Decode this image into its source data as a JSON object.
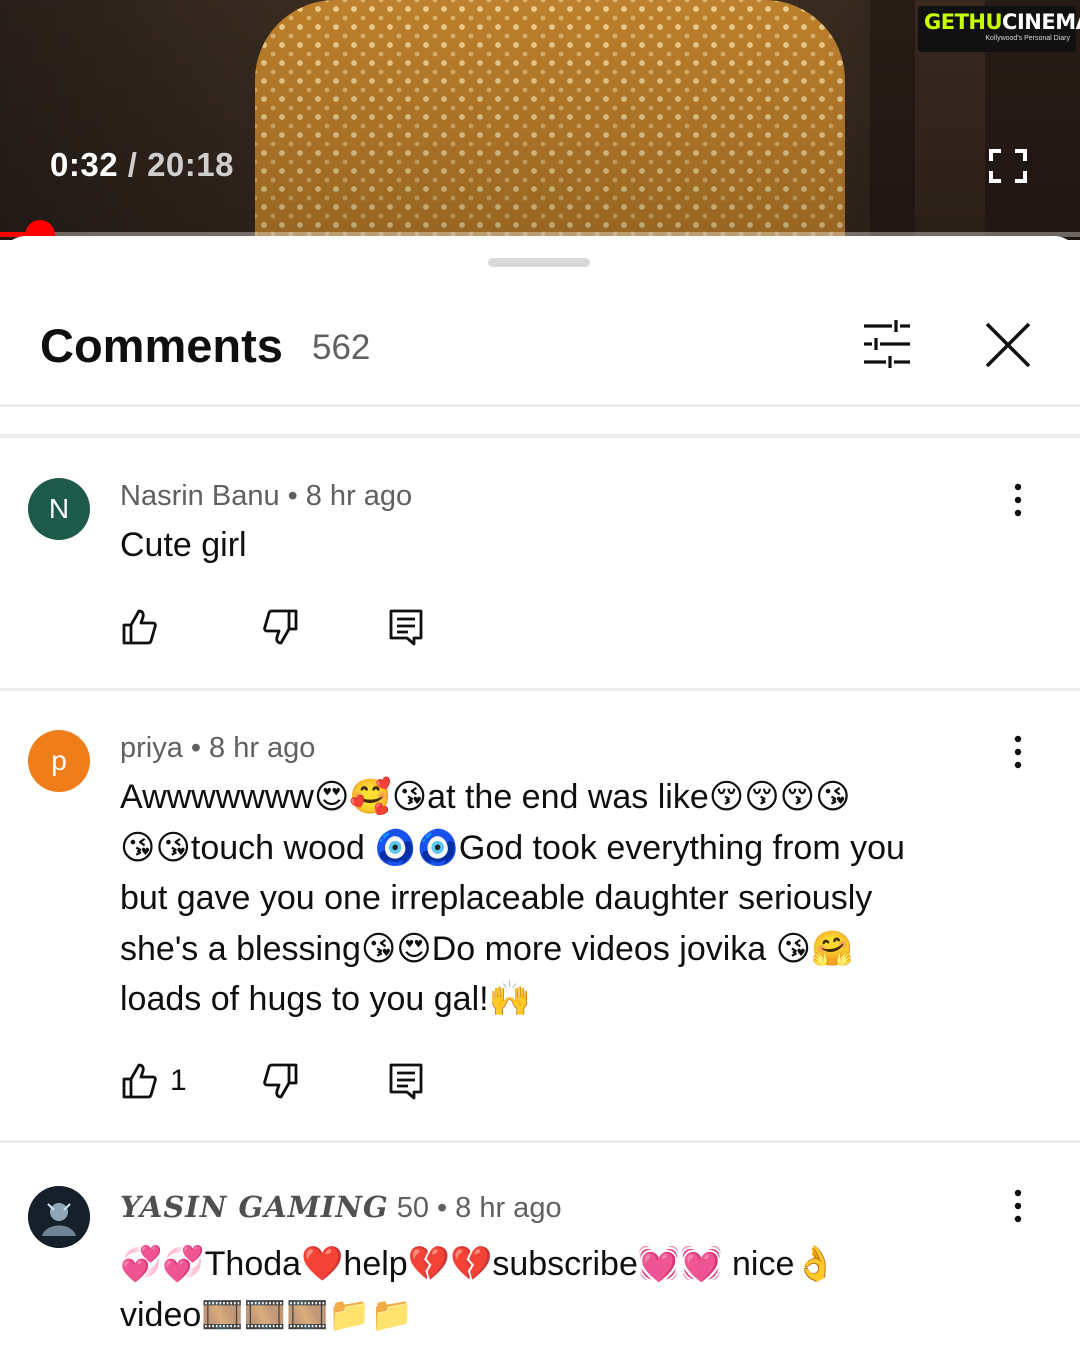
{
  "player": {
    "current_time": "0:32",
    "duration": "/ 20:18",
    "progress_fraction": 0.026
  },
  "watermark": {
    "brand_left": "GETHU",
    "brand_right": "CINEMA",
    "tagline": "Kollywood's Personal Diary"
  },
  "comments_panel": {
    "title": "Comments",
    "count": "562"
  },
  "comments": [
    {
      "avatar_letter": "N",
      "avatar_color": "#1e5a4a",
      "author": "Nasrin Banu",
      "separator": "•",
      "time": "8 hr ago",
      "text": "Cute girl",
      "likes": ""
    },
    {
      "avatar_letter": "p",
      "avatar_color": "#ef7d1a",
      "author": "priya",
      "separator": "•",
      "time": "8 hr ago",
      "text_lines": [
        "Awwwwwww😍🥰😘at the end was like😚😚😚😘",
        "😘😘touch wood 🧿🧿God took everything from you",
        "but gave you one irreplaceable daughter seriously",
        "she's a blessing😘😍Do more videos jovika 😘🤗",
        "loads of hugs to you gal!🙌"
      ],
      "likes": "1"
    },
    {
      "avatar_letter": "",
      "avatar_color": "#1b2530",
      "author": "YASIN GAMING",
      "author_suffix": "50",
      "separator": "•",
      "time": "8 hr ago",
      "text_lines": [
        "💞💞Thoda❤️help💔💔subscribe💓💓 nice👌",
        "video🎞️🎞️🎞️📁📁"
      ]
    }
  ],
  "colors": {
    "accent": "#ff0000",
    "secondary_text": "#606060",
    "primary_text": "#0f0f0f"
  },
  "icons": [
    "fullscreen-icon",
    "filter-icon",
    "close-icon",
    "more-vert-icon",
    "thumbs-up-icon",
    "thumbs-down-icon",
    "reply-icon"
  ]
}
